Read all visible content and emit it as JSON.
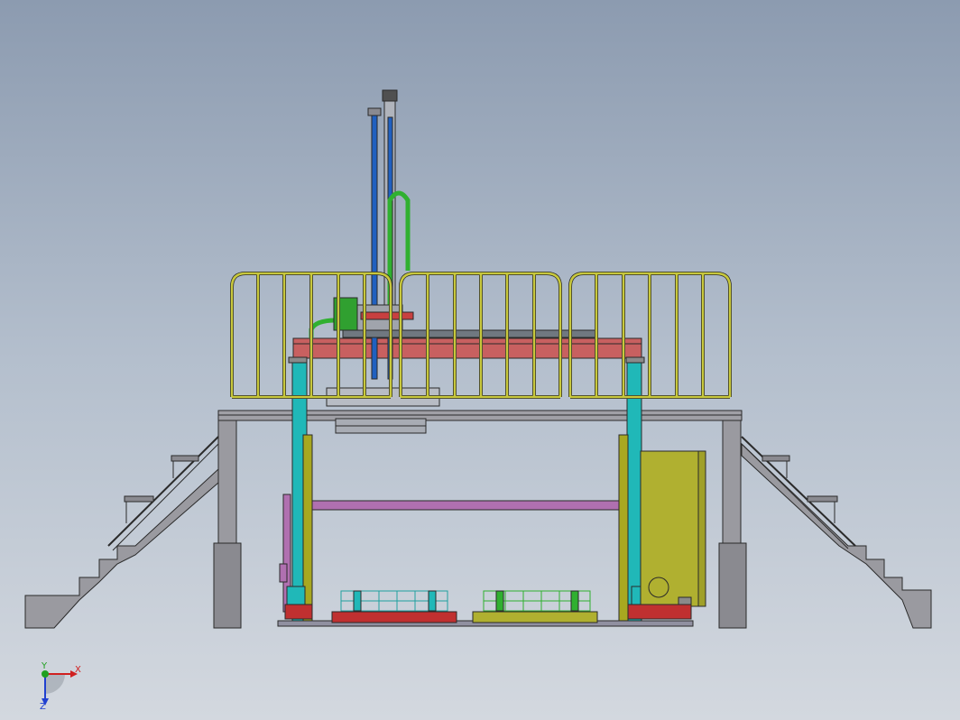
{
  "triad": {
    "x_label": "X",
    "y_label": "Y",
    "z_label": "Z"
  },
  "colors": {
    "railing": "#c8c83c",
    "column_cyan": "#20b8b8",
    "column_olive": "#a8a820",
    "beam_red": "#c86060",
    "deck_gray": "#9a9aa0",
    "cabinet_olive": "#b0b030",
    "purple": "#b070b0",
    "hose_green": "#30b030",
    "mast_blue": "#2060c0"
  }
}
